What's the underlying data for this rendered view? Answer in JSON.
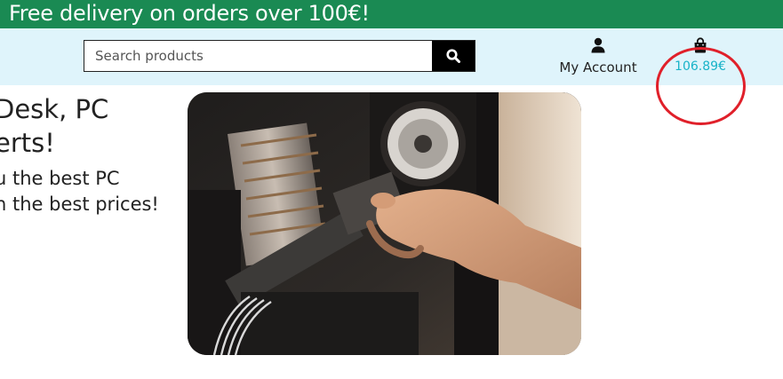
{
  "promo": {
    "text": "Free delivery on orders over 100€!"
  },
  "search": {
    "placeholder": "Search products",
    "value": "",
    "button_icon": "search-icon"
  },
  "account": {
    "label": "My Account",
    "icon": "user-icon"
  },
  "bag": {
    "amount": "106.89€",
    "icon": "shopping-bag-icon"
  },
  "hero": {
    "heading_line1": "Desk, PC",
    "heading_line2": "erts!",
    "text_line1": "u the best PC",
    "text_line2": "n the best prices!"
  },
  "colors": {
    "promo_bg": "#1a8a53",
    "header_bg": "#dff4fb",
    "accent": "#18b3c8",
    "annotation": "#e0202a"
  }
}
